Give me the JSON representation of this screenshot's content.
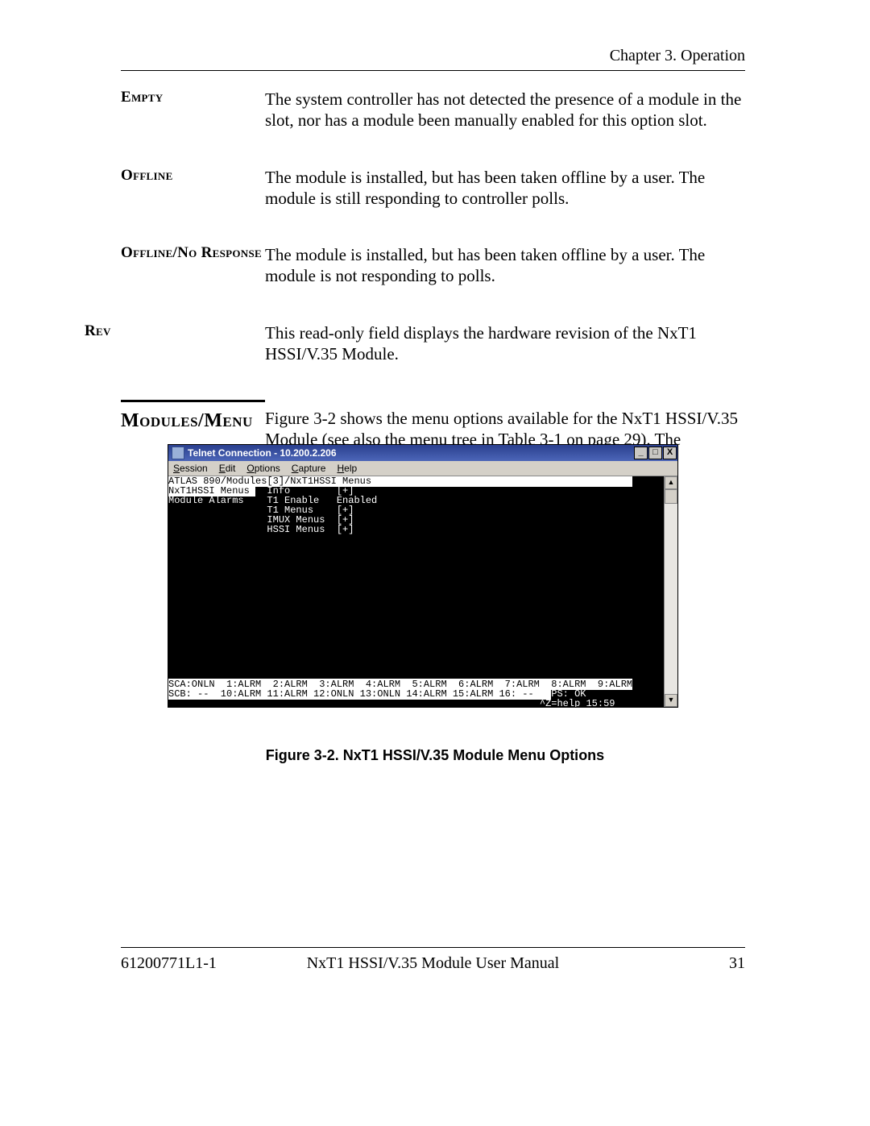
{
  "header": {
    "chapter": "Chapter 3.  Operation"
  },
  "defs": [
    {
      "label": "Empty",
      "text": "The system controller has not detected the presence of a module in the slot, nor has a module been manually enabled for this option slot."
    },
    {
      "label": "Offline",
      "text": "The module is installed, but has been taken offline by a user. The module is still responding to controller polls."
    },
    {
      "label": "Offline/No Response",
      "text": "The module is installed, but has been taken offline by a user. The module is not responding to polls."
    },
    {
      "label": "Rev",
      "text": "This read-only field displays the hardware revision of the NxT1 HSSI/V.35 Module.",
      "outdent": true
    }
  ],
  "section": {
    "heading": "Modules/Menu",
    "text": "Figure 3-2 shows the menu options available for the NxT1 HSSI/V.35 Module (see also the menu tree in Table 3-1 on page 29). The following sections describe these options."
  },
  "telnet": {
    "title": "Telnet Connection - 10.200.2.206",
    "window_buttons": {
      "min": "_",
      "max": "□",
      "close": "X"
    },
    "menubar": [
      "Session",
      "Edit",
      "Options",
      "Capture",
      "Help"
    ],
    "path": "ATLAS 890/Modules[3]/NxT1HSSI Menus",
    "left_items": [
      "NxT1HSSI Menus",
      "Module Alarms"
    ],
    "menu_items": [
      {
        "name": "Info",
        "value": "[+]"
      },
      {
        "name": "T1 Enable",
        "value": "Enabled"
      },
      {
        "name": "T1 Menus",
        "value": "[+]"
      },
      {
        "name": "IMUX Menus",
        "value": "[+]"
      },
      {
        "name": "HSSI Menus",
        "value": "[+]"
      }
    ],
    "status": {
      "line1": "SCA:ONLN  1:ALRM  2:ALRM  3:ALRM  4:ALRM  5:ALRM  6:ALRM  7:ALRM  8:ALRM  9:ALRM",
      "line2_left": "SCB: --  10:ALRM 11:ALRM 12:ONLN 13:ONLN 14:ALRM 15:ALRM 16: --   ",
      "line2_right": "PS: OK",
      "help": "^Z=help 15:59"
    }
  },
  "figure_caption": "Figure 3-2.  NxT1 HSSI/V.35 Module Menu Options",
  "footer": {
    "left": "61200771L1-1",
    "center": "NxT1 HSSI/V.35 Module User Manual",
    "right": "31"
  }
}
